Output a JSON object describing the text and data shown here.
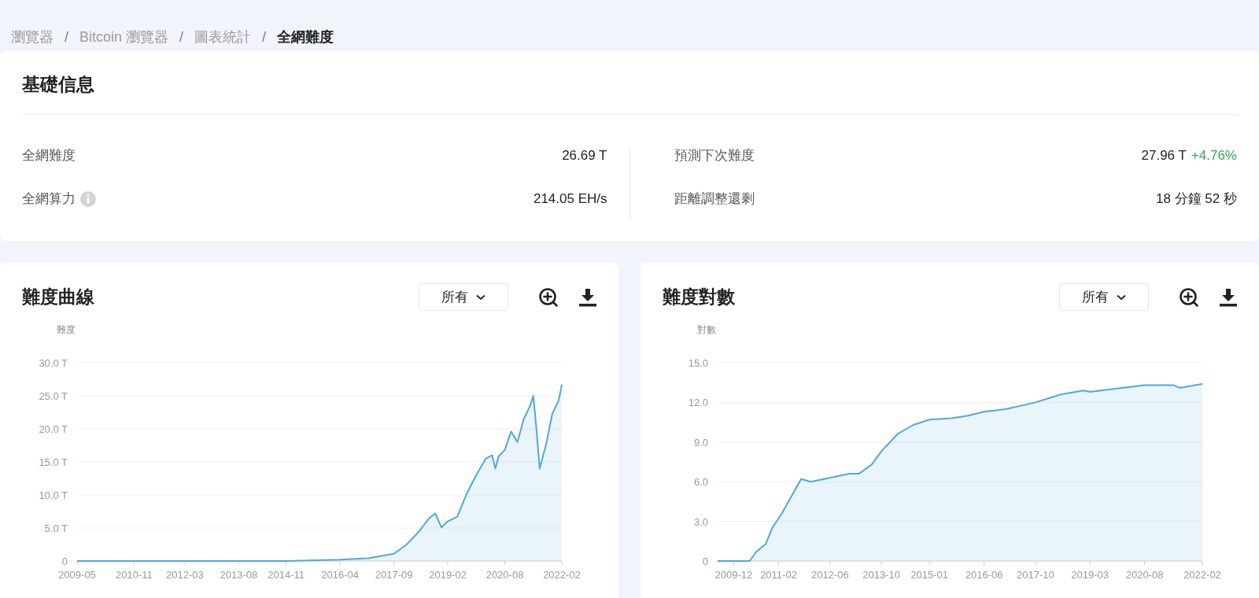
{
  "breadcrumb": [
    {
      "label": "瀏覽器",
      "current": false
    },
    {
      "label": "Bitcoin 瀏覽器",
      "current": false
    },
    {
      "label": "圖表統計",
      "current": false
    },
    {
      "label": "全網難度",
      "current": true
    }
  ],
  "breadcrumb_separator": "/",
  "info": {
    "title": "基礎信息",
    "left": [
      {
        "label": "全網難度",
        "value": "26.69 T",
        "info_icon": false
      },
      {
        "label": "全網算力",
        "value": "214.05 EH/s",
        "info_icon": true
      }
    ],
    "right": [
      {
        "label": "預測下次難度",
        "value": "27.96 T",
        "change": {
          "text": "+4.76%"
        }
      },
      {
        "label": "距離調整還剩",
        "value": "18 分鐘 52 秒"
      }
    ]
  },
  "charts": [
    {
      "title": "難度曲線",
      "range": "所有",
      "chart_data": {
        "type": "area",
        "ylabel": "難度",
        "grid": true,
        "xlim": [
          "2009-05",
          "2022-02"
        ],
        "ylim": [
          0,
          30
        ],
        "yticks": [
          {
            "value": 0,
            "label": "0"
          },
          {
            "value": 5,
            "label": "5.0 T"
          },
          {
            "value": 10,
            "label": "10.0 T"
          },
          {
            "value": 15,
            "label": "15.0 T"
          },
          {
            "value": 20,
            "label": "20.0 T"
          },
          {
            "value": 25,
            "label": "25.0 T"
          },
          {
            "value": 30,
            "label": "30.0 T"
          }
        ],
        "xticks": [
          "2009-05",
          "2010-11",
          "2012-03",
          "2013-08",
          "2014-11",
          "2016-04",
          "2017-09",
          "2019-02",
          "2020-08",
          "2022-02"
        ],
        "x": [
          "2009-05",
          "2010-11",
          "2012-03",
          "2013-08",
          "2014-11",
          "2016-04",
          "2017-01",
          "2017-09",
          "2018-01",
          "2018-05",
          "2018-08",
          "2018-10",
          "2018-12",
          "2019-02",
          "2019-05",
          "2019-08",
          "2019-11",
          "2020-02",
          "2020-04",
          "2020-05",
          "2020-06",
          "2020-08",
          "2020-10",
          "2020-12",
          "2021-02",
          "2021-04",
          "2021-05",
          "2021-06",
          "2021-07",
          "2021-09",
          "2021-11",
          "2022-01",
          "2022-02"
        ],
        "series": [
          {
            "color": "#4fa8dc",
            "values": [
              0,
              0,
              0,
              0,
              0,
              0.2,
              0.4,
              1.1,
              2.5,
              4.5,
              6.4,
              7.2,
              5.1,
              6.0,
              6.7,
              10.2,
              13.0,
              15.5,
              16.0,
              14.0,
              15.8,
              16.8,
              19.6,
              18.0,
              21.5,
              23.5,
              25.0,
              19.9,
              14.0,
              17.6,
              22.3,
              24.3,
              26.7
            ]
          }
        ]
      }
    },
    {
      "title": "難度對數",
      "range": "所有",
      "chart_data": {
        "type": "area",
        "ylabel": "對數",
        "grid": true,
        "xlim": [
          "2009-07",
          "2022-02"
        ],
        "ylim": [
          0,
          15
        ],
        "yticks": [
          {
            "value": 0,
            "label": "0"
          },
          {
            "value": 3,
            "label": "3.0"
          },
          {
            "value": 6,
            "label": "6.0"
          },
          {
            "value": 9,
            "label": "9.0"
          },
          {
            "value": 12,
            "label": "12.0"
          },
          {
            "value": 15,
            "label": "15.0"
          }
        ],
        "xticks": [
          "2009-12",
          "2011-02",
          "2012-06",
          "2013-10",
          "2015-01",
          "2016-06",
          "2017-10",
          "2019-03",
          "2020-08",
          "2022-02"
        ],
        "x": [
          "2009-07",
          "2010-05",
          "2010-07",
          "2010-10",
          "2010-12",
          "2011-03",
          "2011-06",
          "2011-09",
          "2011-12",
          "2012-06",
          "2012-12",
          "2013-03",
          "2013-07",
          "2013-10",
          "2014-03",
          "2014-08",
          "2015-01",
          "2015-08",
          "2016-01",
          "2016-06",
          "2017-01",
          "2017-10",
          "2018-06",
          "2019-01",
          "2019-03",
          "2020-01",
          "2020-08",
          "2021-05",
          "2021-07",
          "2022-02"
        ],
        "series": [
          {
            "color": "#4fa8dc",
            "values": [
              0,
              0,
              0.7,
              1.3,
              2.5,
              3.6,
              4.9,
              6.2,
              6.0,
              6.3,
              6.6,
              6.6,
              7.3,
              8.3,
              9.6,
              10.3,
              10.7,
              10.8,
              11.0,
              11.3,
              11.5,
              12.0,
              12.6,
              12.9,
              12.8,
              13.1,
              13.3,
              13.3,
              13.1,
              13.4
            ]
          }
        ]
      }
    }
  ]
}
